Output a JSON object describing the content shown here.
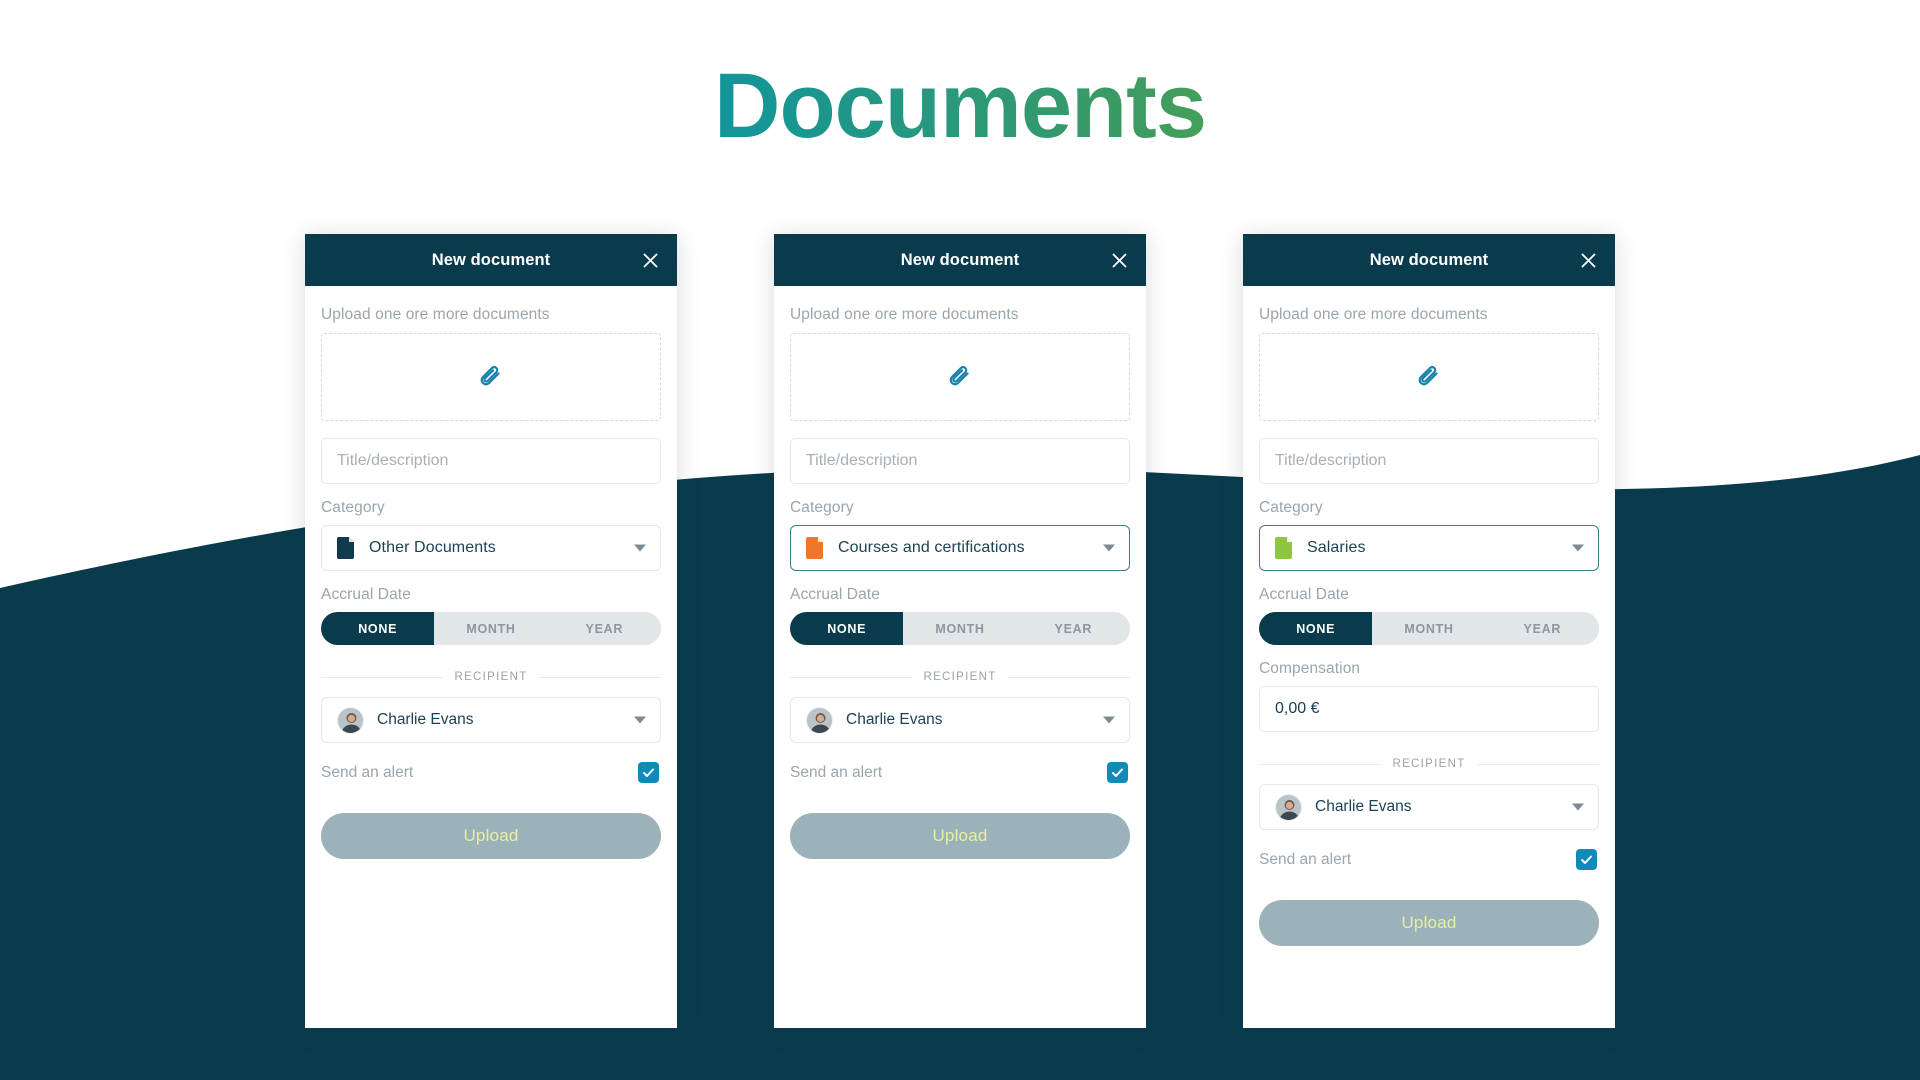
{
  "page": {
    "title": "Documents",
    "background_color": "#0a3b4d",
    "accent_blue": "#108ab8"
  },
  "common": {
    "header_title": "New document",
    "close_icon": "close-icon",
    "upload_hint": "Upload one ore more documents",
    "dropzone_icon": "paperclip-icon",
    "title_placeholder": "Title/description",
    "category_label": "Category",
    "accrual_label": "Accrual Date",
    "accrual_options": [
      "NONE",
      "MONTH",
      "YEAR"
    ],
    "accrual_selected": "NONE",
    "recipient_caption": "RECIPIENT",
    "recipient_name": "Charlie Evans",
    "alert_label": "Send an alert",
    "alert_checked": true,
    "upload_label": "Upload",
    "caret_icon": "chevron-down-icon",
    "avatar_icon": "avatar"
  },
  "cards": [
    {
      "id": "card-other-documents",
      "category_value": "Other Documents",
      "category_icon": "document-icon",
      "category_icon_color": "#123a4d",
      "select_focused": false,
      "has_compensation": false
    },
    {
      "id": "card-courses-certifications",
      "category_value": "Courses and certifications",
      "category_icon": "document-icon",
      "category_icon_color": "#f2762a",
      "select_focused": true,
      "has_compensation": false
    },
    {
      "id": "card-salaries",
      "category_value": "Salaries",
      "category_icon": "document-icon",
      "category_icon_color": "#8ec63f",
      "select_focused": true,
      "has_compensation": true,
      "compensation_label": "Compensation",
      "compensation_value": "0,00 €"
    }
  ]
}
